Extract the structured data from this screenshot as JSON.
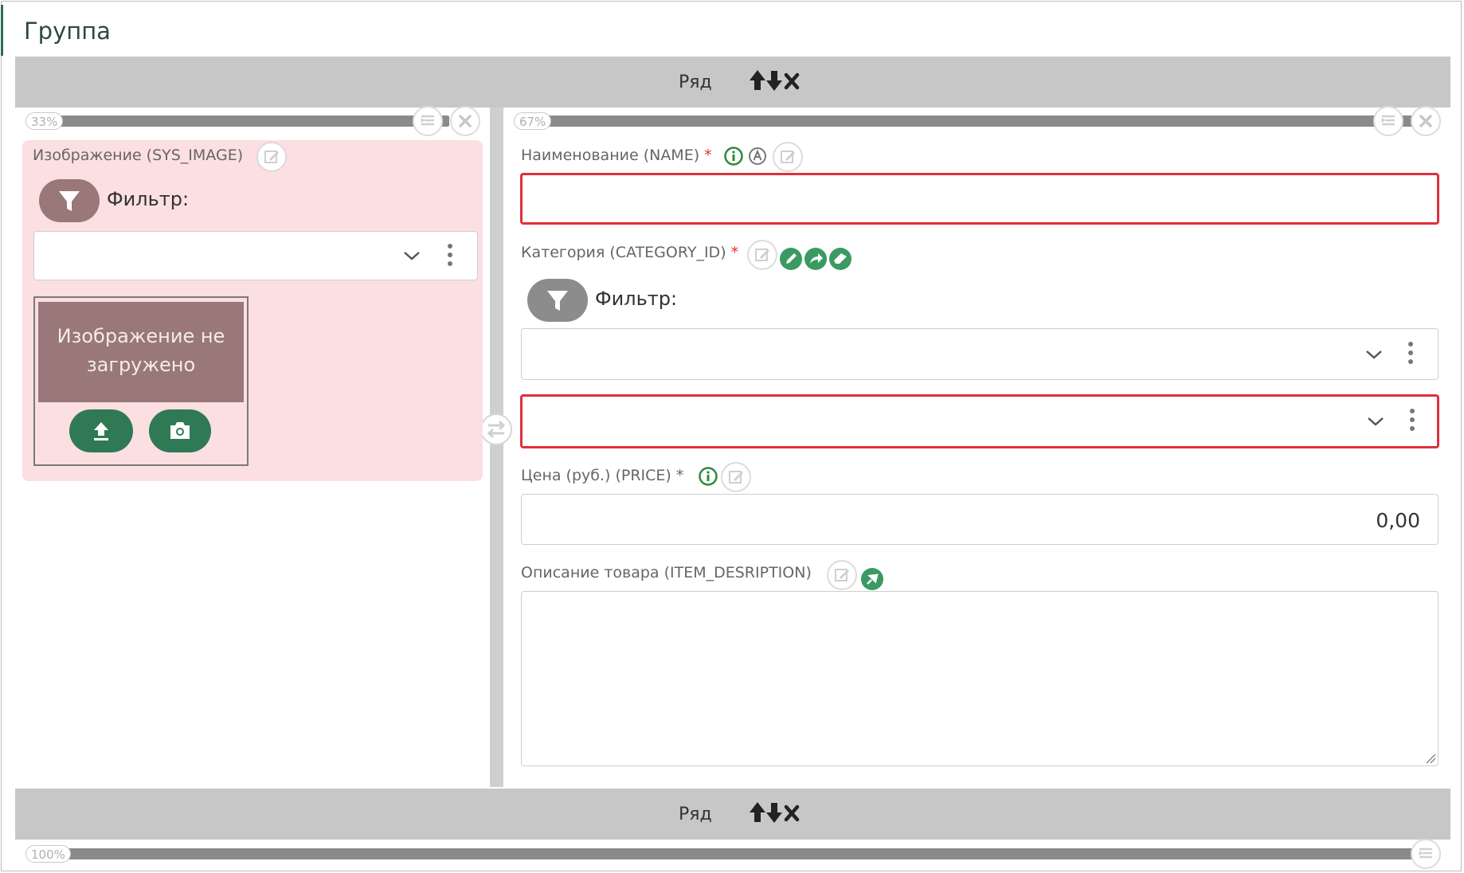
{
  "group": {
    "title": "Группа"
  },
  "rows": [
    {
      "label": "Ряд"
    },
    {
      "label": "Ряд"
    }
  ],
  "columns": {
    "left": {
      "percent": "33%"
    },
    "right": {
      "percent": "67%"
    },
    "bottom": {
      "percent": "100%"
    }
  },
  "fields": {
    "image": {
      "label": "Изображение (SYS_IMAGE)",
      "filter_label": "Фильтр:",
      "placeholder_text": "Изображение не загружено"
    },
    "name": {
      "label": "Наименование (NAME)",
      "required_mark": "*",
      "value": ""
    },
    "category": {
      "label": "Категория (CATEGORY_ID)",
      "required_mark": "*",
      "filter_label": "Фильтр:"
    },
    "price": {
      "label": "Цена (руб.) (PRICE)",
      "required_mark": "*",
      "value": "0,00"
    },
    "description": {
      "label": "Описание товара (ITEM_DESRIPTION)",
      "value": ""
    }
  },
  "colors": {
    "row_bar": "#c7c7c7",
    "accent_green": "#2f7a55",
    "error_red": "#e0303a",
    "filter_pill_left": "#9a7778",
    "filter_pill_right": "#8c8c8c",
    "pink_card": "#fcdfe1"
  },
  "icons": [
    "arrow-up-icon",
    "arrow-down-icon",
    "close-icon",
    "edit-icon",
    "info-icon",
    "auto-icon",
    "pencil-icon",
    "share-icon",
    "eraser-icon",
    "filter-icon",
    "chevron-down-icon",
    "kebab-icon",
    "upload-icon",
    "camera-icon",
    "swap-icon",
    "settings-list-icon",
    "pin-icon",
    "resize-icon"
  ]
}
